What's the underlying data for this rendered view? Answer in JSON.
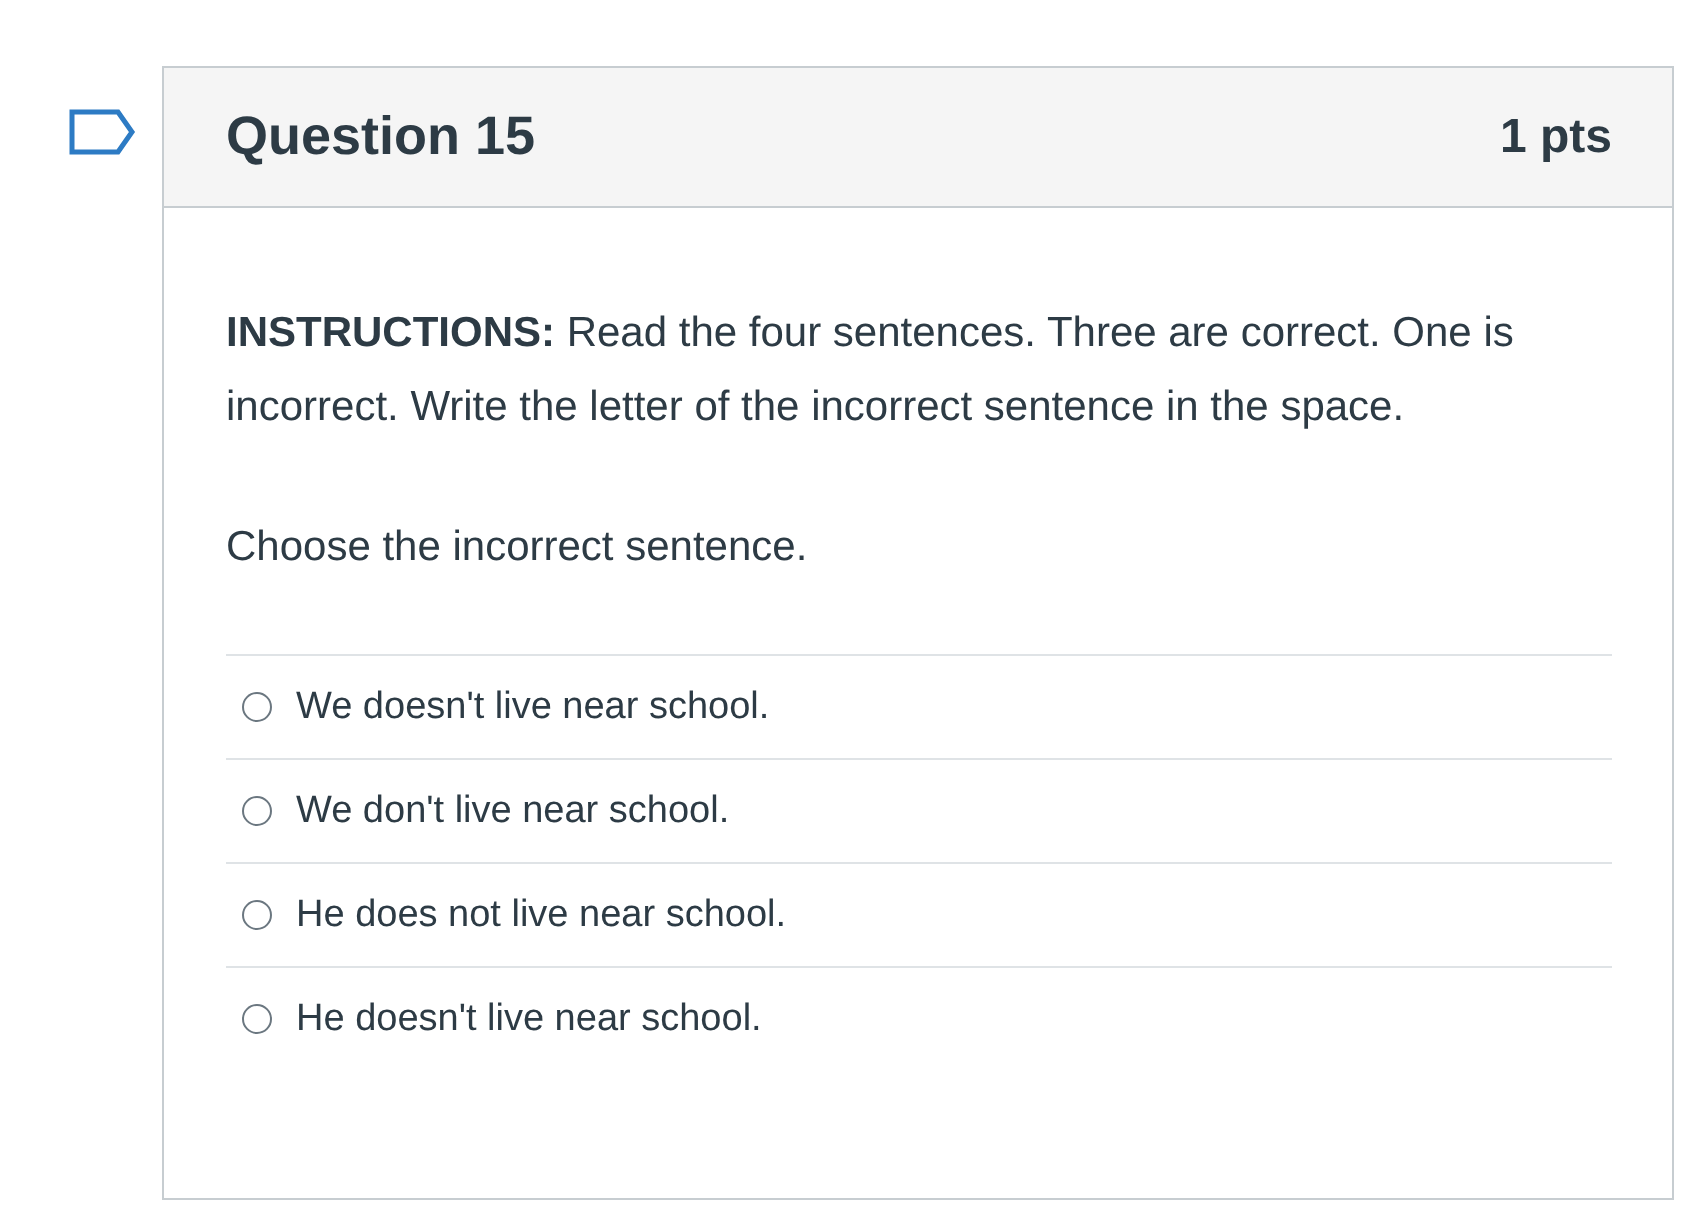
{
  "question": {
    "title": "Question 15",
    "points": "1 pts",
    "flagged": false
  },
  "instructions": "**INSTRUCTIONS:** Read the four sentences. Three are correct. One is incorrect. Write the letter of the incorrect sentence in the space.",
  "prompt": "Choose the incorrect sentence.",
  "answers": [
    {
      "label": "We doesn't live near school.",
      "selected": false
    },
    {
      "label": "We don't live near school.",
      "selected": false
    },
    {
      "label": "He does not live near school.",
      "selected": false
    },
    {
      "label": "He doesn't live near school.",
      "selected": false
    }
  ]
}
